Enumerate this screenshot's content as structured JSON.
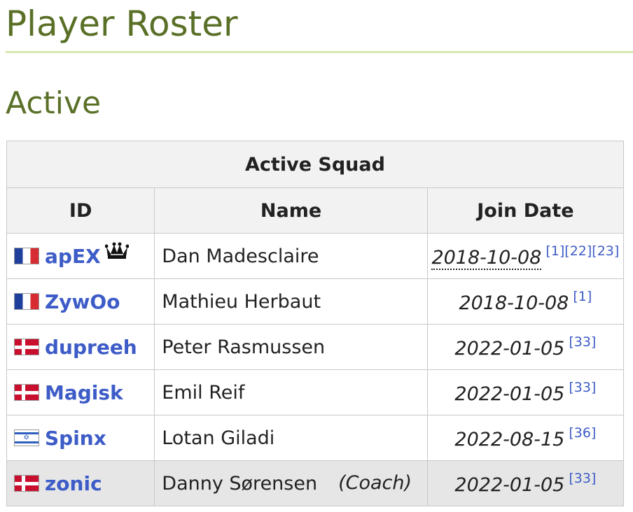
{
  "page": {
    "title": "Player Roster",
    "section": "Active"
  },
  "table": {
    "caption": "Active Squad",
    "headers": {
      "id": "ID",
      "name": "Name",
      "join_date": "Join Date"
    },
    "rows": [
      {
        "flag": "france-flag",
        "id": "apEX",
        "captain": true,
        "name": "Dan Madesclaire",
        "role": "",
        "join_date": "2018-10-08",
        "refs": "[1][22][23]"
      },
      {
        "flag": "france-flag",
        "id": "ZywOo",
        "captain": false,
        "name": "Mathieu Herbaut",
        "role": "",
        "join_date": "2018-10-08",
        "refs": "[1]"
      },
      {
        "flag": "denmark-flag",
        "id": "dupreeh",
        "captain": false,
        "name": "Peter Rasmussen",
        "role": "",
        "join_date": "2022-01-05",
        "refs": "[33]"
      },
      {
        "flag": "denmark-flag",
        "id": "Magisk",
        "captain": false,
        "name": "Emil Reif",
        "role": "",
        "join_date": "2022-01-05",
        "refs": "[33]"
      },
      {
        "flag": "israel-flag",
        "id": "Spinx",
        "captain": false,
        "name": "Lotan Giladi",
        "role": "",
        "join_date": "2022-08-15",
        "refs": "[36]"
      },
      {
        "flag": "denmark-flag",
        "id": "zonic",
        "captain": false,
        "name": "Danny Sørensen",
        "role": "(Coach)",
        "join_date": "2022-01-05",
        "refs": "[33]"
      }
    ]
  },
  "icons": {
    "captain": "crown-icon"
  },
  "colors": {
    "heading": "#5a7027",
    "link": "#3d5cc7",
    "rule": "#d7e8b0",
    "coach_row_bg": "#e6e6e6"
  }
}
